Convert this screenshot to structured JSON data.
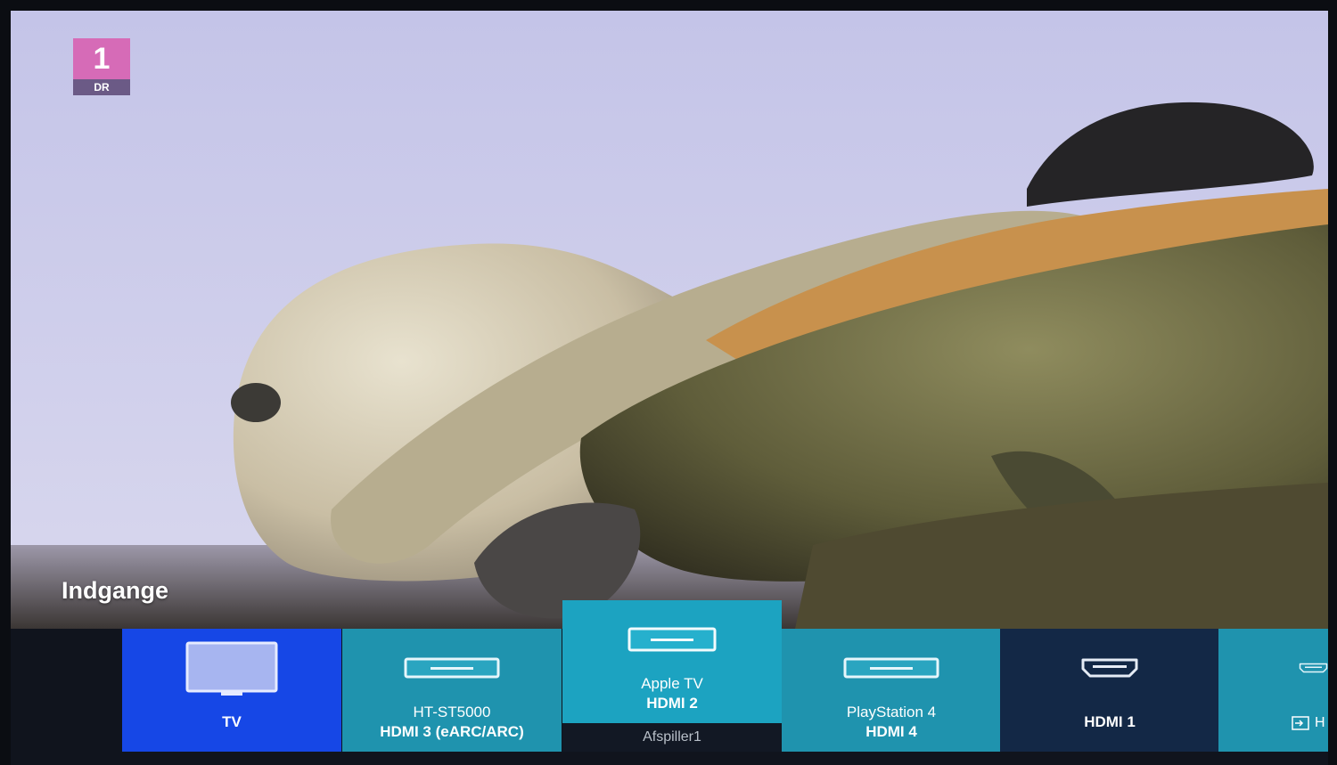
{
  "channel_logo": {
    "number": "1",
    "brand": "DR"
  },
  "section_title": "Indgange",
  "inputs": [
    {
      "name": "TV",
      "sub": "",
      "icon": "tv-icon",
      "state": "selected"
    },
    {
      "name": "HT-ST5000",
      "sub": "HDMI 3 (eARC/ARC)",
      "icon": "media-player-icon",
      "state": "normal"
    },
    {
      "name": "Apple TV",
      "sub": "HDMI 2",
      "icon": "media-player-icon",
      "state": "focused",
      "caption": "Afspiller1"
    },
    {
      "name": "PlayStation 4",
      "sub": "HDMI 4",
      "icon": "media-player-icon",
      "state": "normal"
    },
    {
      "name": "HDMI 1",
      "sub": "",
      "icon": "hdmi-port-icon",
      "state": "normal"
    },
    {
      "name": "H",
      "sub": "",
      "icon": "hdmi-port-icon",
      "state": "partial"
    }
  ],
  "colors": {
    "selected_tile": "#1647e6",
    "focused_tile": "#1ca3c1",
    "normal_tile": "#1f93ae",
    "hdmi_tile": "#132846",
    "bar_background": "#10141d"
  }
}
